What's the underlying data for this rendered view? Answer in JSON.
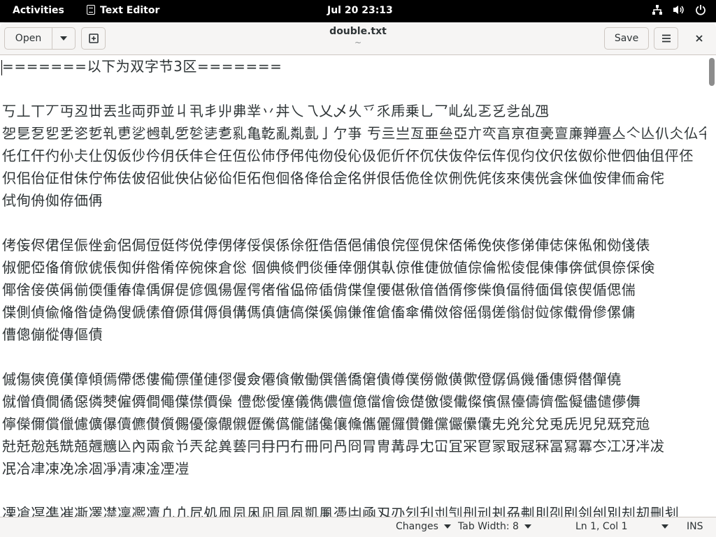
{
  "topbar": {
    "activities": "Activities",
    "app_name": "Text Editor",
    "clock": "Jul 20  23:13",
    "icons": [
      "network-icon",
      "volume-icon",
      "power-icon"
    ]
  },
  "header": {
    "open_label": "Open",
    "title": "double.txt",
    "subtitle": "~",
    "save_label": "Save"
  },
  "editor": {
    "lines": [
      "=======以下为双字节3区=======",
      "",
      "丂丄丅丆丏丒丗丟丠両丣並丩丮丯丱丳丵丷丼乀乁乂乄乆乊乑乕乗乚乛乢乣乤乥乧乨乪",
      "乫乬乭乮乯乲乴乵乶乷乸乹乺乻乼乽乿亀亁亂亃亄亅亇亊  亐亖亗亙亜亝亞亣亪亯亰亱亴亶亷亸亹亼亽亾仈仌仏仐仒",
      "仛仜仠仢仦仧仩仭仮仯仱仴仸仹仺仼仾伀伂伃伄伅伆伇伈伋伌伒伓伔伕伖伜伝伡伣伨伩伬伭伮伱伳伵伷伹伻伾",
      "伿佀佁佂佄佅佇佈佉佊佋佌佒佔佖佡佢佦佨佪佫佭佮佱佲併佷佸佹佺佽侀侁侂侅來侇侊侌侎侐侒侓侕侖侘",
      "侙侚侜侞侟価侢",
      "",
      "侤侫侭侰侱侲侳侴侶侷侸侹侺侻侼侽侾俀俁係俆俇俈俉俋俌俍俒俓俔俕俖俙俛俠俢俤俥俧俫俬俰俲俴俵",
      "俶俷俹俻俼俽俿倀倁倂倃倄倅倇倈倉倊  個倎倐們倓倕倖倗倛倝倞倠倢倣値倧倫倯倰倱倲倳倴倵倶倷倸倹",
      "倻倽倿偀偁偂偄偅偆偉偊偋偍偐偑偒偓偔偖偗偘偙偛偝偞偟偠偡偢偣偤偦偧偨偩偪偫偭偮偯偰偱偲偳",
      "偞側偵偸偹偺偼偽傁傂傃傄傆傇傉傊傋傌傎傏傐傑傒傓傔傕傖傗傘備傚傛傜傝傞傟傠傡傢傤傦傪傫傭",
      "傮傯傰傱傳傴債",
      "",
      "傶傷傸傹傼傽傾傿僀僁僂僃僄僅僆僇僈僉僊僋僌働僎僐僑僒僓僔僕僗僘僙僛僜僝僞僟僠僡僢僣僤僥",
      "僦僧僨僩僪僫僯僰僱僲僴僶僷僸價僺  僼僽僾僿儀儁儂儃億儅儈儉儊儌儍儎儏儐儑儓儔儕儖儗儘儙儚儛",
      "儜儝儞償儠儢儣儤儥儦儧儨儩優儫儬儭儮儯儰儱儲儳儴儵儶儷儸儹儺儻儼儽儾兂兇兊兌兎兏児兒兓兗兘",
      "兙兛兝兞兟兡兣兤兦內兩兪兯兲兺兾兿冃冄円冇冊冋冎冏冐冑冓冔冘冚冝冞冟冡冣冦冧冨冩冪冭冮冴冸冹",
      "冺冾冿凁凂凃凅凈凊凍凎凐凒",
      "",
      "凓凔凕凖凗凘凙凚凜凞凟凢凣凥処凧凨凩凪凬凮凱凲凴凷凾刄刅刉刋刌刏刐刓刔刕刜刞刟刡刢刣別刦刧刪刬"
    ]
  },
  "status": {
    "changes": "Changes",
    "tab_width": "Tab Width: 8",
    "position": "Ln 1, Col 1",
    "mode": "INS"
  }
}
